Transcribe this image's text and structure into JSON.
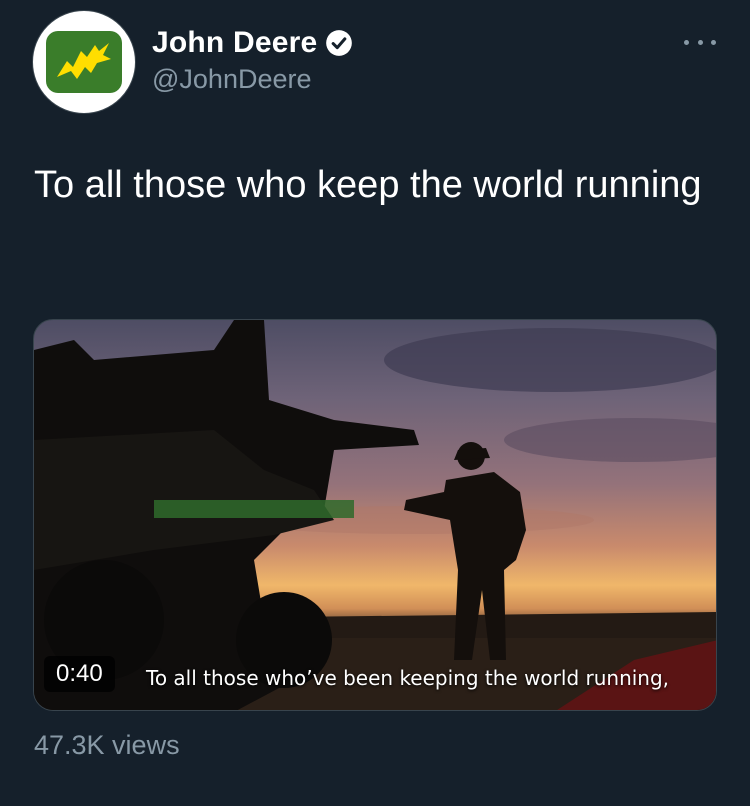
{
  "tweet": {
    "display_name": "John Deere",
    "handle": "@JohnDeere",
    "text": "To all those who keep the world running",
    "verified_icon": "verified-badge-icon",
    "more_icon": "more-options-icon"
  },
  "video": {
    "duration": "0:40",
    "subtitle": "To all those who’ve been keeping the world running,"
  },
  "stats": {
    "views": "47.3K views"
  },
  "colors": {
    "background": "#15202b",
    "secondary_text": "#8899a6",
    "brand_green": "#367c2b",
    "brand_yellow": "#ffde00"
  }
}
